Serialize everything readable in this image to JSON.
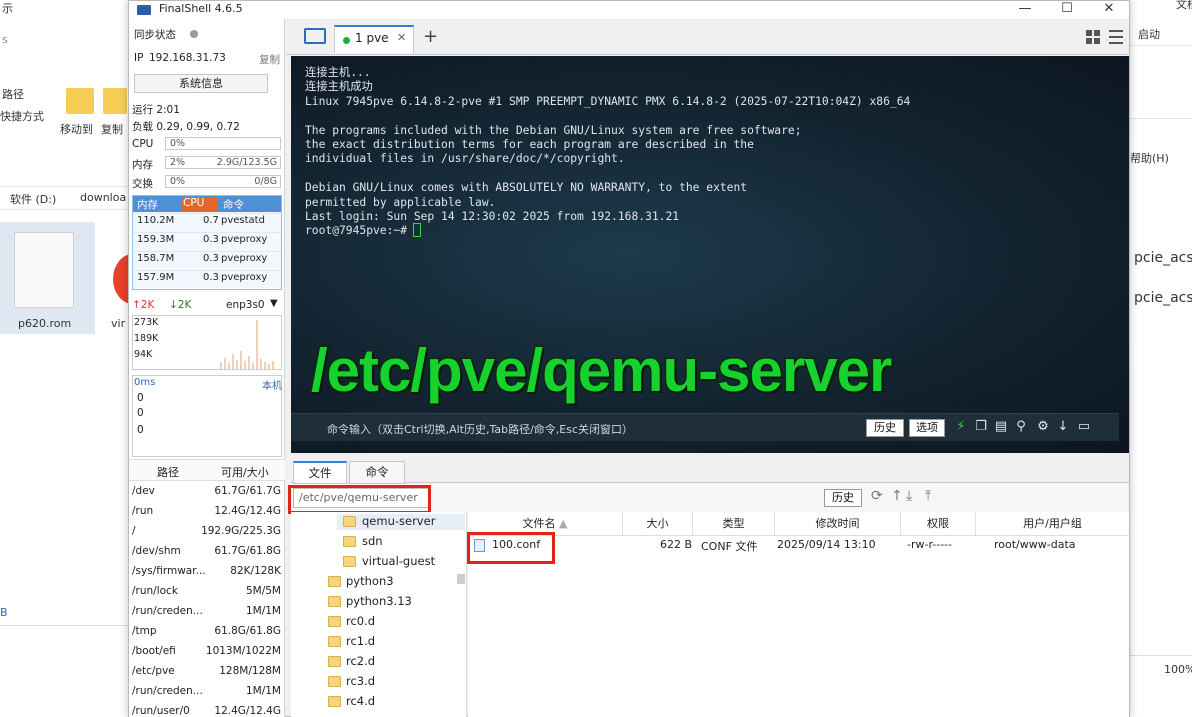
{
  "explorer": {
    "top_glyph": "示",
    "s_glyph": "s",
    "path_label": "路径",
    "shortcut_label": "快捷方式",
    "move_to": "移动到",
    "copy_to": "复制",
    "drive_path": "软件 (D:)",
    "drive_sub": "downloa",
    "file1": "p620.rom",
    "file2": "vir",
    "b_glyph": "B"
  },
  "rightbg": {
    "top": "文档",
    "start": "启动",
    "help": "帮助(H)",
    "line1": "pcie_acs",
    "line2": "pcie_acs",
    "zoom": "100%"
  },
  "window": {
    "title": "FinalShell 4.6.5",
    "minimize": "—",
    "maximize": "☐",
    "close": "✕"
  },
  "left": {
    "sync_status": "同步状态",
    "ip_label": "IP",
    "ip": "192.168.31.73",
    "copy": "复制",
    "sysinfo": "系统信息",
    "uptime": "运行 2:01",
    "load": "负载 0.29, 0.99, 0.72",
    "cpu_label": "CPU",
    "cpu_value": "0%",
    "mem_label": "内存",
    "mem_pct": "2%",
    "mem_value": "2.9G/123.5G",
    "swap_label": "交换",
    "swap_pct": "0%",
    "swap_value": "0/8G",
    "proc_headers": [
      "内存",
      "CPU",
      "命令"
    ],
    "processes": [
      {
        "mem": "110.2M",
        "cpu": "0.7",
        "cmd": "pvestatd"
      },
      {
        "mem": "159.3M",
        "cpu": "0.3",
        "cmd": "pveproxy"
      },
      {
        "mem": "158.7M",
        "cpu": "0.3",
        "cmd": "pveproxy"
      },
      {
        "mem": "157.9M",
        "cpu": "0.3",
        "cmd": "pveproxy"
      }
    ],
    "net_up": "↑2K",
    "net_down": "↓2K",
    "iface": "enp3s0",
    "net_scale": [
      "273K",
      "189K",
      "94K"
    ],
    "latency": "0ms",
    "local": "本机",
    "lat_vals": [
      "0",
      "0",
      "0"
    ],
    "disk_headers": [
      "路径",
      "可用/大小"
    ],
    "disks": [
      {
        "path": "/dev",
        "size": "61.7G/61.7G"
      },
      {
        "path": "/run",
        "size": "12.4G/12.4G"
      },
      {
        "path": "/",
        "size": "192.9G/225.3G"
      },
      {
        "path": "/dev/shm",
        "size": "61.7G/61.8G"
      },
      {
        "path": "/sys/firmwar...",
        "size": "82K/128K"
      },
      {
        "path": "/run/lock",
        "size": "5M/5M"
      },
      {
        "path": "/run/creden...",
        "size": "1M/1M"
      },
      {
        "path": "/tmp",
        "size": "61.8G/61.8G"
      },
      {
        "path": "/boot/efi",
        "size": "1013M/1022M"
      },
      {
        "path": "/etc/pve",
        "size": "128M/128M"
      },
      {
        "path": "/run/creden...",
        "size": "1M/1M"
      },
      {
        "path": "/run/user/0",
        "size": "12.4G/12.4G"
      }
    ]
  },
  "tabs": {
    "session": "1 pve",
    "close": "✕",
    "add": "+"
  },
  "terminal": {
    "text": "连接主机...\n连接主机成功\nLinux 7945pve 6.14.8-2-pve #1 SMP PREEMPT_DYNAMIC PMX 6.14.8-2 (2025-07-22T10:04Z) x86_64\n\nThe programs included with the Debian GNU/Linux system are free software;\nthe exact distribution terms for each program are described in the\nindividual files in /usr/share/doc/*/copyright.\n\nDebian GNU/Linux comes with ABSOLUTELY NO WARRANTY, to the extent\npermitted by applicable law.\nLast login: Sun Sep 14 12:30:02 2025 from 192.168.31.21\nroot@7945pve:~# ",
    "overlay": "/etc/pve/qemu-server",
    "cmd_placeholder": "命令输入（双击Ctrl切换,Alt历史,Tab路径/命令,Esc关闭窗口）",
    "history": "历史",
    "options": "选项"
  },
  "files": {
    "tab_files": "文件",
    "tab_commands": "命令",
    "path": "/etc/pve/qemu-server",
    "history": "历史",
    "tree": [
      "qemu-server",
      "sdn",
      "virtual-guest",
      "python3",
      "python3.13",
      "rc0.d",
      "rc1.d",
      "rc2.d",
      "rc3.d",
      "rc4.d"
    ],
    "columns": [
      "文件名",
      "大小",
      "类型",
      "修改时间",
      "权限",
      "用户/用户组"
    ],
    "rows": [
      {
        "name": "100.conf",
        "size": "622 B",
        "type": "CONF 文件",
        "mtime": "2025/09/14 13:10",
        "perm": "-rw-r-----",
        "owner": "root/www-data"
      }
    ]
  }
}
